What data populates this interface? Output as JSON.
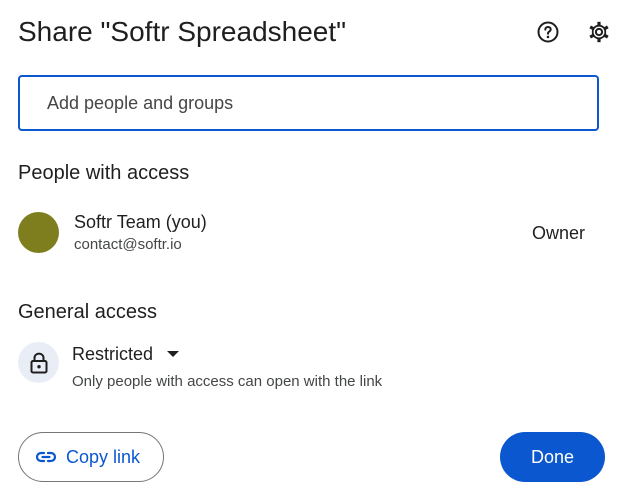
{
  "dialog": {
    "title": "Share \"Softr Spreadsheet\"",
    "help_icon": "help-circle-icon",
    "settings_icon": "gear-icon"
  },
  "add_people": {
    "placeholder": "Add people and groups",
    "value": ""
  },
  "people_with_access": {
    "heading": "People with access",
    "people": [
      {
        "name": "Softr Team (you)",
        "email": "contact@softr.io",
        "role": "Owner",
        "avatar_color": "#7e7e1e"
      }
    ]
  },
  "general_access": {
    "heading": "General access",
    "icon": "lock-icon",
    "selected": "Restricted",
    "description": "Only people with access can open with the link"
  },
  "footer": {
    "copy_link_label": "Copy link",
    "copy_link_icon": "link-icon",
    "done_label": "Done"
  },
  "colors": {
    "accent": "#0b57d0",
    "text_primary": "#1f1f1f",
    "text_secondary": "#444746",
    "lock_bg": "#e9eef6"
  }
}
